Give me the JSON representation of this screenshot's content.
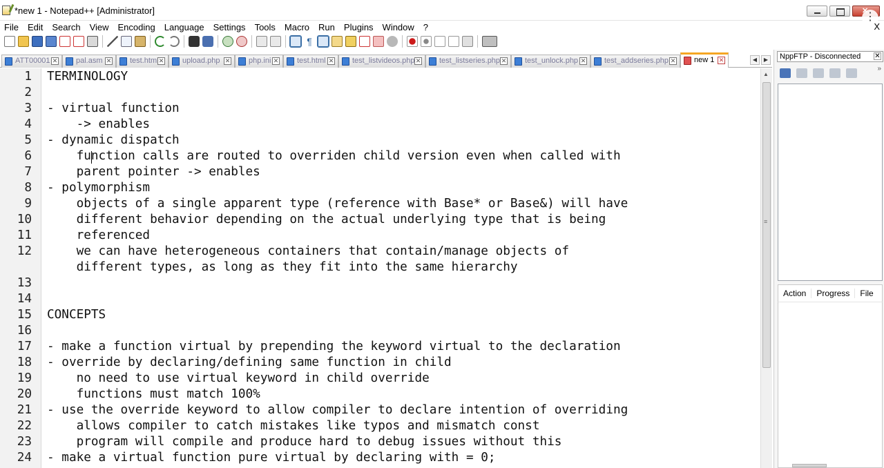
{
  "window": {
    "title": "*new 1 - Notepad++ [Administrator]",
    "title_icon": "notepad-icon",
    "menu_close": "X"
  },
  "menu": [
    "File",
    "Edit",
    "Search",
    "View",
    "Encoding",
    "Language",
    "Settings",
    "Tools",
    "Macro",
    "Run",
    "Plugins",
    "Window",
    "?"
  ],
  "toolbar": {
    "icons": [
      "new-file-icon",
      "open-file-icon",
      "save-icon",
      "save-all-icon",
      "close-icon",
      "close-all-icon",
      "print-icon",
      "sep",
      "cut-icon",
      "copy-icon",
      "paste-icon",
      "sep",
      "undo-icon",
      "redo-icon",
      "sep",
      "find-icon",
      "replace-icon",
      "sep",
      "zoom-in-icon",
      "zoom-out-icon",
      "sep",
      "sync-v-icon",
      "sync-h-icon",
      "sep",
      "wrap-icon",
      "all-chars-icon",
      "indent-guide-icon",
      "udl-icon",
      "doc-map-icon",
      "function-list-icon",
      "folder-workspace-icon",
      "monitoring-icon",
      "sep",
      "record-macro-icon",
      "stop-record-icon",
      "play-macro-icon",
      "run-multiple-icon",
      "save-macro-icon",
      "sep",
      "ftp-plugin-icon"
    ],
    "icon_colors": {
      "accent": "#3d7fd6",
      "record": "#cc1a1a",
      "undo": "#2f8a2f"
    }
  },
  "tabs": [
    {
      "label": "ATT00001",
      "active": false
    },
    {
      "label": "pal.asm",
      "active": false
    },
    {
      "label": "test.html",
      "active": false
    },
    {
      "label": "upload.php",
      "active": false
    },
    {
      "label": "php.ini",
      "active": false
    },
    {
      "label": "test.html",
      "active": false
    },
    {
      "label": "test_listvideos.php",
      "active": false
    },
    {
      "label": "test_listseries.php",
      "active": false
    },
    {
      "label": "test_unlock.php",
      "active": false
    },
    {
      "label": "test_addseries.php",
      "active": false
    },
    {
      "label": "new 1",
      "active": true
    }
  ],
  "tab_scroll": {
    "left": "◀",
    "right": "▶"
  },
  "editor": {
    "lines": [
      {
        "n": "1",
        "text": "TERMINOLOGY"
      },
      {
        "n": "2",
        "text": ""
      },
      {
        "n": "3",
        "text": "- virtual function"
      },
      {
        "n": "4",
        "text": "    -> enables"
      },
      {
        "n": "5",
        "text": "- dynamic dispatch"
      },
      {
        "n": "6",
        "text": "    function calls are routed to overriden child version even when called with"
      },
      {
        "n": "7",
        "text": "    parent pointer -> enables"
      },
      {
        "n": "8",
        "text": "- polymorphism"
      },
      {
        "n": "9",
        "text": "    objects of a single apparent type (reference with Base* or Base&) will have"
      },
      {
        "n": "10",
        "text": "    different behavior depending on the actual underlying type that is being"
      },
      {
        "n": "11",
        "text": "    referenced"
      },
      {
        "n": "12",
        "text": "    we can have heterogeneous containers that contain/manage objects of"
      },
      {
        "n": "",
        "text": "    different types, as long as they fit into the same hierarchy"
      },
      {
        "n": "13",
        "text": ""
      },
      {
        "n": "14",
        "text": ""
      },
      {
        "n": "15",
        "text": "CONCEPTS"
      },
      {
        "n": "16",
        "text": ""
      },
      {
        "n": "17",
        "text": "- make a function virtual by prepending the keyword virtual to the declaration"
      },
      {
        "n": "18",
        "text": "- override by declaring/defining same function in child"
      },
      {
        "n": "19",
        "text": "    no need to use virtual keyword in child override"
      },
      {
        "n": "20",
        "text": "    functions must match 100%"
      },
      {
        "n": "21",
        "text": "- use the override keyword to allow compiler to declare intention of overriding"
      },
      {
        "n": "22",
        "text": "    allows compiler to catch mistakes like typos and mismatch const"
      },
      {
        "n": "23",
        "text": "    program will compile and produce hard to debug issues without this"
      },
      {
        "n": "24",
        "text": "- make a virtual function pure virtual by declaring with = 0;"
      }
    ]
  },
  "ftp_panel": {
    "title": "NppFTP - Disconnected",
    "close": "✕",
    "more": "»",
    "tools": [
      "connect-icon",
      "settings-icon",
      "download-icon",
      "upload-icon",
      "refresh-icon"
    ],
    "queue_columns": [
      "Action",
      "Progress",
      "File"
    ]
  },
  "scroll": {
    "up": "▲",
    "down": "▼",
    "grip": "≡"
  },
  "kebab": "⋮"
}
